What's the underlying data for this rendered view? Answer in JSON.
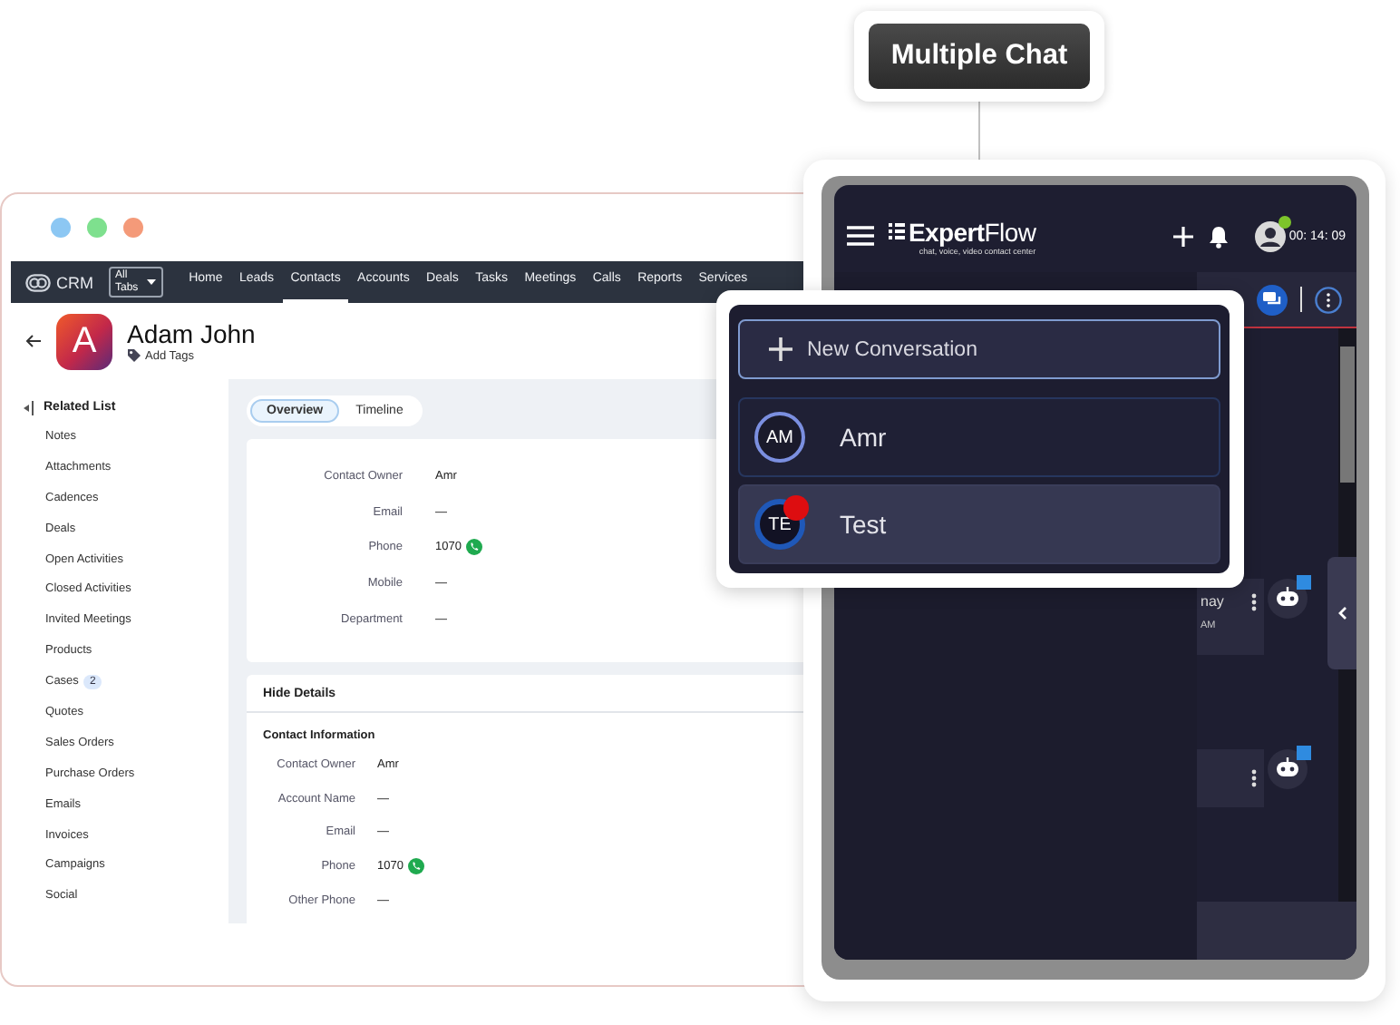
{
  "callout": {
    "label": "Multiple Chat"
  },
  "crm": {
    "nav": {
      "logo": "CRM",
      "all_tabs": "All Tabs",
      "items": [
        {
          "label": "Home",
          "selected": false
        },
        {
          "label": "Leads",
          "selected": false
        },
        {
          "label": "Contacts",
          "selected": true
        },
        {
          "label": "Accounts",
          "selected": false
        },
        {
          "label": "Deals",
          "selected": false
        },
        {
          "label": "Tasks",
          "selected": false
        },
        {
          "label": "Meetings",
          "selected": false
        },
        {
          "label": "Calls",
          "selected": false
        },
        {
          "label": "Reports",
          "selected": false
        },
        {
          "label": "Services",
          "selected": false
        }
      ]
    },
    "contact": {
      "initial": "A",
      "name": "Adam John",
      "add_tags": "Add Tags"
    },
    "related_list": {
      "title": "Related List",
      "items": [
        {
          "label": "Notes"
        },
        {
          "label": "Attachments"
        },
        {
          "label": "Cadences"
        },
        {
          "label": "Deals"
        },
        {
          "label": "Open Activities"
        },
        {
          "label": "Closed Activities"
        },
        {
          "label": "Invited Meetings"
        },
        {
          "label": "Products"
        },
        {
          "label": "Cases",
          "badge": "2"
        },
        {
          "label": "Quotes"
        },
        {
          "label": "Sales Orders"
        },
        {
          "label": "Purchase Orders"
        },
        {
          "label": "Emails"
        },
        {
          "label": "Invoices"
        },
        {
          "label": "Campaigns"
        },
        {
          "label": "Social"
        }
      ]
    },
    "tabs": [
      {
        "label": "Overview",
        "selected": true
      },
      {
        "label": "Timeline",
        "selected": false
      }
    ],
    "overview": [
      {
        "label": "Contact Owner",
        "value": "Amr",
        "whatsapp": false
      },
      {
        "label": "Email",
        "value": "—",
        "whatsapp": false
      },
      {
        "label": "Phone",
        "value": "1070",
        "whatsapp": true
      },
      {
        "label": "Mobile",
        "value": "—",
        "whatsapp": false
      },
      {
        "label": "Department",
        "value": "—",
        "whatsapp": false
      }
    ],
    "details": {
      "toggle": "Hide Details",
      "section": "Contact Information",
      "fields": [
        {
          "label": "Contact Owner",
          "value": "Amr",
          "whatsapp": false
        },
        {
          "label": "Account Name",
          "value": "—",
          "whatsapp": false
        },
        {
          "label": "Email",
          "value": "—",
          "whatsapp": false
        },
        {
          "label": "Phone",
          "value": "1070",
          "whatsapp": true
        },
        {
          "label": "Other Phone",
          "value": "—",
          "whatsapp": false
        }
      ]
    }
  },
  "chat": {
    "brand": {
      "bold": "Expert",
      "light": "Flow",
      "tagline": "chat, voice, video contact center"
    },
    "agent_online": true,
    "timer": "00: 14: 09",
    "new_conversation": "New Conversation",
    "conversations": [
      {
        "initials": "AM",
        "name": "Amr",
        "selected": false,
        "unread": false
      },
      {
        "initials": "TE",
        "name": "Test",
        "selected": true,
        "unread": true
      }
    ],
    "messages": [
      {
        "kind": "text",
        "text": "nay",
        "time": "AM"
      },
      {
        "kind": "blank"
      }
    ]
  }
}
